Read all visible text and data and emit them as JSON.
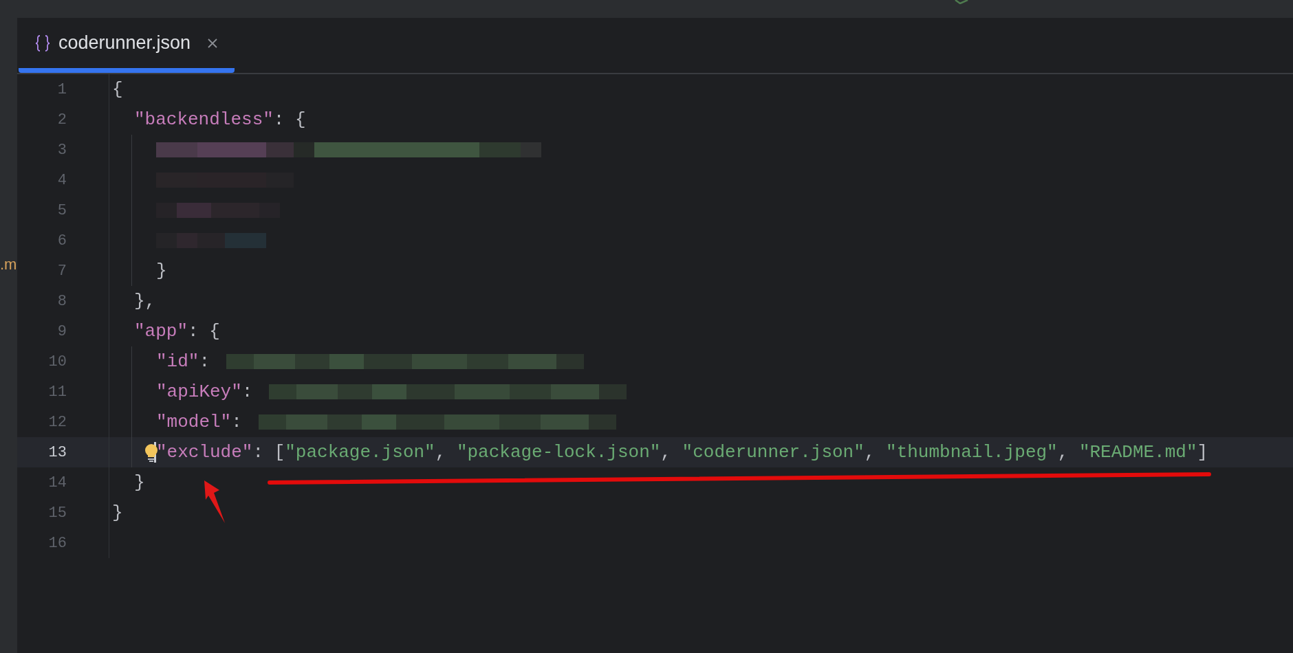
{
  "side_fragment": ".m",
  "tabs": [
    {
      "label": "coderunner.json",
      "selected": true
    }
  ],
  "lines": [
    {
      "number": "1",
      "tokens": [
        {
          "kind": "punct",
          "text": "{"
        }
      ],
      "children": [
        {
          "number": "2",
          "tokens": [
            {
              "kind": "key",
              "text": "\"backendless\""
            },
            {
              "kind": "punct",
              "text": ": {"
            }
          ],
          "children": [
            {
              "number": "3",
              "redacted": true
            },
            {
              "number": "4",
              "redacted": true
            },
            {
              "number": "5",
              "redacted": true
            },
            {
              "number": "6",
              "redacted": true
            },
            {
              "number": "7",
              "tokens": [
                {
                  "kind": "punct",
                  "text": "}"
                }
              ]
            }
          ]
        },
        {
          "number": "8",
          "tokens": [
            {
              "kind": "punct",
              "text": "},"
            }
          ]
        },
        {
          "number": "9",
          "tokens": [
            {
              "kind": "key",
              "text": "\"app\""
            },
            {
              "kind": "punct",
              "text": ": {"
            }
          ],
          "children": [
            {
              "number": "10",
              "tokens": [
                {
                  "kind": "key",
                  "text": "\"id\""
                },
                {
                  "kind": "punct",
                  "text": ":"
                }
              ],
              "redacted_value": true
            },
            {
              "number": "11",
              "tokens": [
                {
                  "kind": "key",
                  "text": "\"apiKey\""
                },
                {
                  "kind": "punct",
                  "text": ":"
                }
              ],
              "redacted_value": true
            },
            {
              "number": "12",
              "tokens": [
                {
                  "kind": "key",
                  "text": "\"model\""
                },
                {
                  "kind": "punct",
                  "text": ":"
                }
              ],
              "redacted_value": true
            },
            {
              "number": "13",
              "current": true,
              "bulb": true,
              "tokens": [
                {
                  "kind": "key",
                  "text": "\"exclude\""
                },
                {
                  "kind": "punct",
                  "text": ": ["
                },
                {
                  "kind": "string",
                  "text": "\"package.json\""
                },
                {
                  "kind": "punct",
                  "text": ", "
                },
                {
                  "kind": "string",
                  "text": "\"package-lock.json\""
                },
                {
                  "kind": "punct",
                  "text": ", "
                },
                {
                  "kind": "string",
                  "text": "\"coderunner.json\""
                },
                {
                  "kind": "punct",
                  "text": ", "
                },
                {
                  "kind": "string",
                  "text": "\"thumbnail.jpeg\""
                },
                {
                  "kind": "punct",
                  "text": ", "
                },
                {
                  "kind": "string",
                  "text": "\"README.md\""
                },
                {
                  "kind": "punct",
                  "text": "]"
                }
              ]
            }
          ]
        },
        {
          "number": "14",
          "tokens": [
            {
              "kind": "punct",
              "text": "}"
            }
          ]
        }
      ]
    },
    {
      "number": "15",
      "tokens": [
        {
          "kind": "punct",
          "text": "}"
        }
      ]
    },
    {
      "number": "16"
    }
  ]
}
